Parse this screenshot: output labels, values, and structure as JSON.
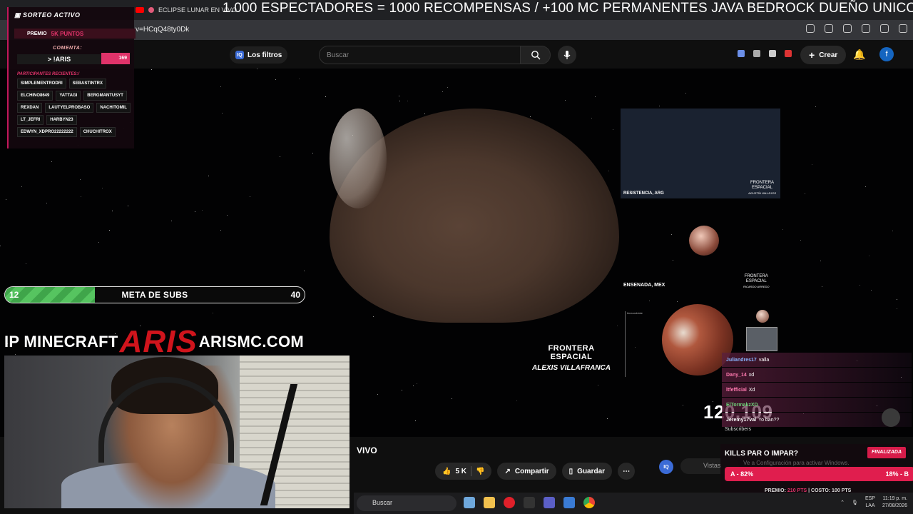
{
  "browser": {
    "tab_title": "ECLIPSE LUNAR EN VIVO",
    "url": "v=HCqQ48ty0Dk",
    "marquee": "1.000 ESPECTADORES = 1000 RECOMPENSAS / +100 MC PERMANENTES JAVA BEDROCK DUEÑO UNICO"
  },
  "youtube": {
    "filters_label": "Los filtros",
    "search_placeholder": "Buscar",
    "create_label": "Crear",
    "avatar_letter": "f"
  },
  "video": {
    "top_panel_location": "RESISTENCIA, ARG",
    "top_panel_credit": "AGUSTÍN VALLEJOS",
    "ensenada_location": "ENSENADA, MEX",
    "ensenada_credit": "RICARDO ARREDO",
    "frontera_line1": "FRONTERA",
    "frontera_line2": "ESPACIAL",
    "credit_name": "ALEXIS VILLAFRANCA",
    "viewer_count": "120.109",
    "subscribers_label": "Subscribers",
    "timeanddate": "timeanddate"
  },
  "sorteo": {
    "title": "SORTEO ACTIVO",
    "prize_label": "PREMIO",
    "prize_value": "5K PUNTOS",
    "comment_label": "COMENTA:",
    "command": "> !ARIS",
    "count": "169",
    "participants_label": "PARTICIPANTES RECIENTES:/",
    "participants": [
      "SIMPLEMENTRODRI",
      "SEBASTINTRX",
      "ELCHINO8649",
      "YATTAGI",
      "BERGMANTUSYT",
      "REXDAN",
      "LAUTYELPROBASO",
      "NACHITOMIL",
      "LT_JEFRI",
      "HARBYN23",
      "EDWYN_XDPRO22222222",
      "CHUCHITROX"
    ]
  },
  "meta": {
    "current": "12",
    "label": "META DE SUBS",
    "goal": "40",
    "progress": 0.3
  },
  "ip": {
    "prefix": "IP MINECRAFT",
    "brand": "ARIS",
    "domain": "ARISMC.COM"
  },
  "below_video": {
    "status": "VIVO",
    "likes": "5 K",
    "share_label": "Compartir",
    "save_label": "Guardar",
    "vistas_label": "Vistas"
  },
  "chat": [
    {
      "user": "Juliandres17",
      "msg": "valla"
    },
    {
      "user": "Dany_14",
      "msg": "xd"
    },
    {
      "user": "ltfefficial",
      "msg": "Xd"
    },
    {
      "user": "ElTormakzXD",
      "msg": ""
    },
    {
      "user": "Jeremy17val",
      "msg": "Yo ban??"
    }
  ],
  "kills": {
    "title": "KILLS PAR O IMPAR?",
    "status": "FINALIZADA",
    "activate_hint": "Ve a Configuración para activar Windows.",
    "option_a": "A - 82%",
    "option_b": "18% - B",
    "prize_text": "PREMIO:",
    "prize_value": "210 PTS",
    "cost_text": "| COSTO: 100 PTS"
  },
  "taskbar": {
    "search_label": "Buscar",
    "lang_top": "ESP",
    "lang_bottom": "LAA",
    "time": "11:19 p. m.",
    "date": "27/08/2026"
  },
  "colors": {
    "accent_pink": "#e0336a",
    "aris_red": "#d0141c",
    "progress_green": "#56c460"
  }
}
